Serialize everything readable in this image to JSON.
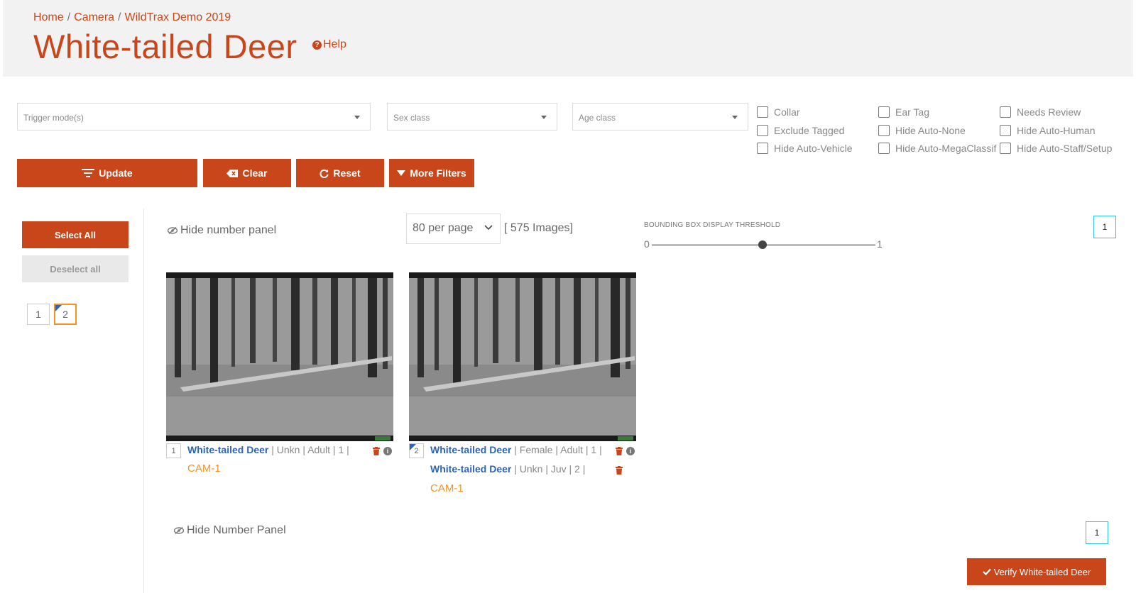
{
  "breadcrumb": [
    {
      "label": "Home"
    },
    {
      "label": "Camera"
    },
    {
      "label": "WildTrax Demo 2019"
    }
  ],
  "page": {
    "title": "White-tailed Deer",
    "help_label": "Help"
  },
  "filters": {
    "trigger_mode": {
      "placeholder": "Trigger mode(s)"
    },
    "sex_class": {
      "placeholder": "Sex class"
    },
    "age_class": {
      "placeholder": "Age class"
    },
    "checkboxes": [
      {
        "label": "Collar",
        "checked": false
      },
      {
        "label": "Ear Tag",
        "checked": false
      },
      {
        "label": "Needs Review",
        "checked": false
      },
      {
        "label": "Exclude Tagged",
        "checked": false
      },
      {
        "label": "Hide Auto-None",
        "checked": false
      },
      {
        "label": "Hide Auto-Human",
        "checked": false
      },
      {
        "label": "Hide Auto-Vehicle",
        "checked": false
      },
      {
        "label": "Hide Auto-MegaClassif",
        "checked": false
      },
      {
        "label": "Hide Auto-Staff/Setup",
        "checked": false
      }
    ]
  },
  "actions": {
    "update": "Update",
    "clear": "Clear",
    "reset": "Reset",
    "more_filters": "More Filters"
  },
  "selection": {
    "select_all": "Select All",
    "deselect_all": "Deselect all",
    "numbers": [
      "1",
      "2"
    ],
    "active_number": "2"
  },
  "gallery": {
    "hide_number_panel_top": "Hide number panel",
    "hide_number_panel_bottom": "Hide Number Panel",
    "per_page": "80 per page",
    "image_count": "[ 575 Images]",
    "threshold_label": "BOUNDING BOX DISPLAY THRESHOLD",
    "threshold_min": "0",
    "threshold_max": "1",
    "threshold_value": 0.5,
    "page_top": "1",
    "page_bottom": "1",
    "verify_label": "Verify White-tailed Deer",
    "images": [
      {
        "number": "1",
        "tags": [
          {
            "species": "White-tailed Deer",
            "details": " | Unkn | Adult | 1 | "
          }
        ],
        "camera": "CAM-1"
      },
      {
        "number": "2",
        "tags": [
          {
            "species": "White-tailed Deer",
            "details": " | Female | Adult | 1 | "
          },
          {
            "species": "White-tailed Deer",
            "details": " | Unkn | Juv | 2 | "
          }
        ],
        "camera": "CAM-1"
      }
    ]
  },
  "colors": {
    "primary": "#c8461a",
    "species_link": "#2b63b5",
    "camera": "#f7931e",
    "page_box_border": "#2ec4d6"
  }
}
